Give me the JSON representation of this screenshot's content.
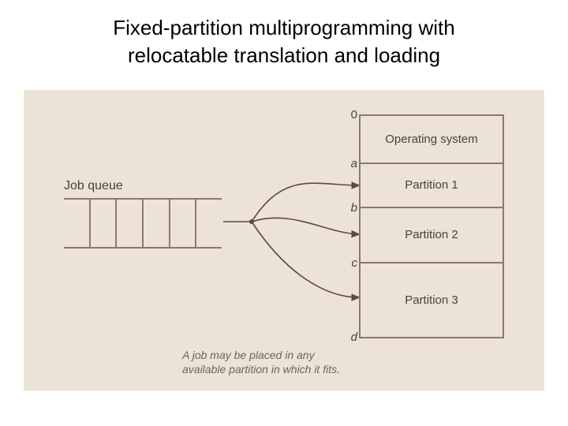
{
  "title_l1": "Fixed-partition multiprogramming with",
  "title_l2": "relocatable translation and loading",
  "queue_label": "Job queue",
  "memory": {
    "os": "Operating system",
    "p1": "Partition 1",
    "p2": "Partition 2",
    "p3": "Partition 3"
  },
  "addr": {
    "zero": "0",
    "a": "a",
    "b": "b",
    "c": "c",
    "d": "d"
  },
  "caption_l1": "A job may be placed in any",
  "caption_l2": "available partition in which it fits."
}
